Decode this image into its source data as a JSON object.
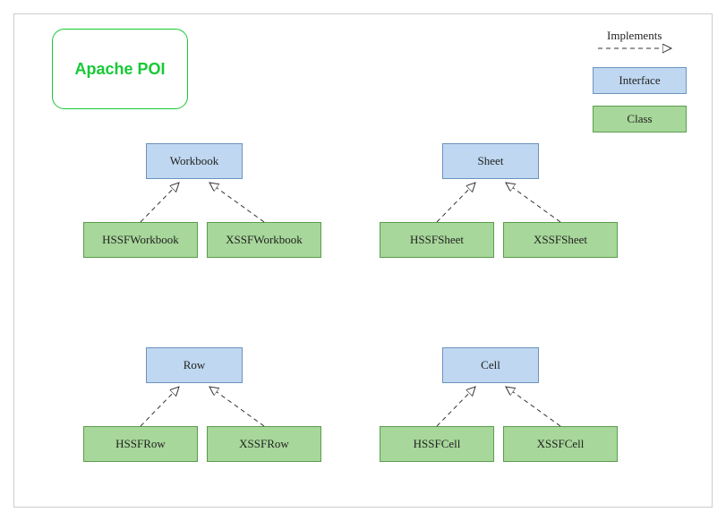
{
  "title": "Apache POI",
  "legend": {
    "implements": "Implements",
    "interface": "Interface",
    "class": "Class"
  },
  "groups": [
    {
      "interface": "Workbook",
      "classes": [
        "HSSFWorkbook",
        "XSSFWorkbook"
      ]
    },
    {
      "interface": "Sheet",
      "classes": [
        "HSSFSheet",
        "XSSFSheet"
      ]
    },
    {
      "interface": "Row",
      "classes": [
        "HSSFRow",
        "XSSFRow"
      ]
    },
    {
      "interface": "Cell",
      "classes": [
        "HSSFCell",
        "XSSFCell"
      ]
    }
  ],
  "colors": {
    "interface_bg": "#bfd7f0",
    "interface_border": "#6b93bd",
    "class_bg": "#a7d79a",
    "class_border": "#5a9e4c",
    "title_color": "#17c935"
  }
}
